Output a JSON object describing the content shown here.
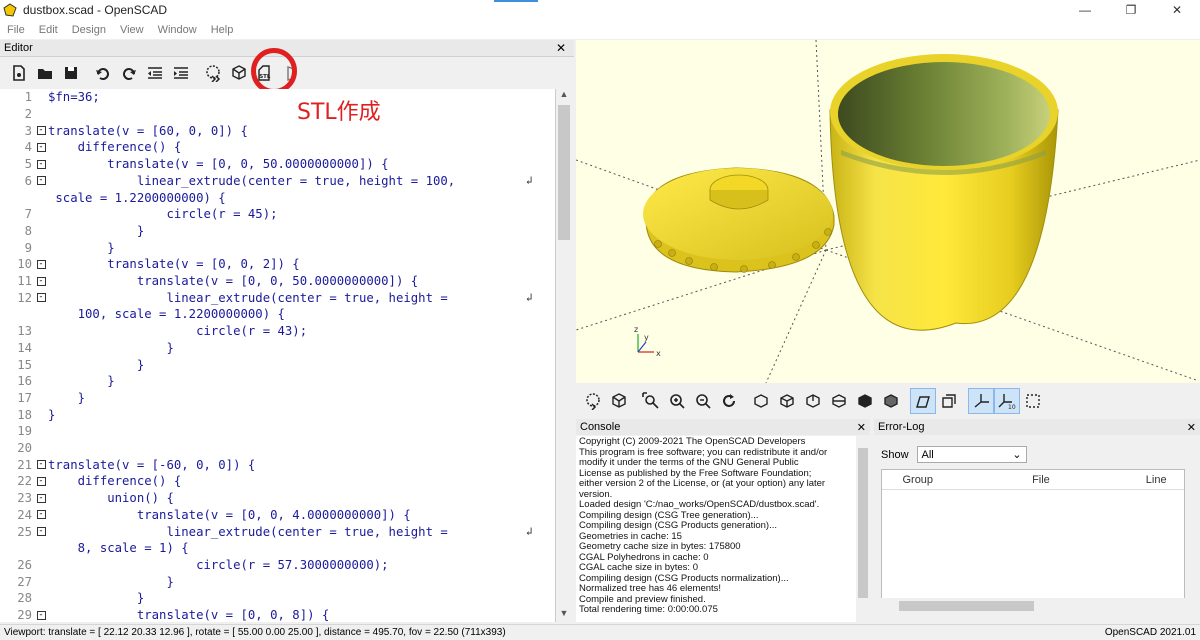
{
  "window": {
    "title": "dustbox.scad - OpenSCAD",
    "controls": [
      "—",
      "❐",
      "✕"
    ]
  },
  "menu": [
    "File",
    "Edit",
    "Design",
    "View",
    "Window",
    "Help"
  ],
  "editor": {
    "title": "Editor",
    "close": "✕",
    "annotation": "STL作成",
    "wrap_symbol": "↲",
    "lines": [
      {
        "n": "1",
        "fold": "",
        "text": "$fn=36;"
      },
      {
        "n": "2",
        "fold": "",
        "text": ""
      },
      {
        "n": "3",
        "fold": "-",
        "text": "translate(v = [60, 0, 0]) {"
      },
      {
        "n": "4",
        "fold": "-",
        "text": "    difference() {"
      },
      {
        "n": "5",
        "fold": "-",
        "text": "        translate(v = [0, 0, 50.0000000000]) {"
      },
      {
        "n": "6",
        "fold": "-",
        "text": "            linear_extrude(center = true, height = 100,",
        "wrap": true
      },
      {
        "n": "",
        "fold": "",
        "text": " scale = 1.2200000000) {"
      },
      {
        "n": "7",
        "fold": "",
        "text": "                circle(r = 45);"
      },
      {
        "n": "8",
        "fold": "",
        "text": "            }"
      },
      {
        "n": "9",
        "fold": "",
        "text": "        }"
      },
      {
        "n": "10",
        "fold": "-",
        "text": "        translate(v = [0, 0, 2]) {"
      },
      {
        "n": "11",
        "fold": "-",
        "text": "            translate(v = [0, 0, 50.0000000000]) {"
      },
      {
        "n": "12",
        "fold": "-",
        "text": "                linear_extrude(center = true, height =",
        "wrap": true
      },
      {
        "n": "",
        "fold": "",
        "text": "    100, scale = 1.2200000000) {"
      },
      {
        "n": "13",
        "fold": "",
        "text": "                    circle(r = 43);"
      },
      {
        "n": "14",
        "fold": "",
        "text": "                }"
      },
      {
        "n": "15",
        "fold": "",
        "text": "            }"
      },
      {
        "n": "16",
        "fold": "",
        "text": "        }"
      },
      {
        "n": "17",
        "fold": "",
        "text": "    }"
      },
      {
        "n": "18",
        "fold": "",
        "text": "}"
      },
      {
        "n": "19",
        "fold": "",
        "text": ""
      },
      {
        "n": "20",
        "fold": "",
        "text": ""
      },
      {
        "n": "21",
        "fold": "-",
        "text": "translate(v = [-60, 0, 0]) {"
      },
      {
        "n": "22",
        "fold": "-",
        "text": "    difference() {"
      },
      {
        "n": "23",
        "fold": "-",
        "text": "        union() {"
      },
      {
        "n": "24",
        "fold": "-",
        "text": "            translate(v = [0, 0, 4.0000000000]) {"
      },
      {
        "n": "25",
        "fold": "-",
        "text": "                linear_extrude(center = true, height =",
        "wrap": true
      },
      {
        "n": "",
        "fold": "",
        "text": "    8, scale = 1) {"
      },
      {
        "n": "26",
        "fold": "",
        "text": "                    circle(r = 57.3000000000);"
      },
      {
        "n": "27",
        "fold": "",
        "text": "                }"
      },
      {
        "n": "28",
        "fold": "",
        "text": "            }"
      },
      {
        "n": "29",
        "fold": "-",
        "text": "            translate(v = [0, 0, 8]) {"
      }
    ]
  },
  "console": {
    "title": "Console",
    "close": "✕",
    "lines": [
      "Copyright (C) 2009-2021 The OpenSCAD Developers",
      "This program is free software; you can redistribute it and/or",
      "modify it under the terms of the GNU General Public",
      "License as published by the Free Software Foundation;",
      "either version 2 of the License, or (at your option) any later",
      "version.",
      "",
      "Loaded design 'C:/nao_works/OpenSCAD/dustbox.scad'.",
      "Compiling design (CSG Tree generation)...",
      "Compiling design (CSG Products generation)...",
      "Geometries in cache: 15",
      "Geometry cache size in bytes: 175800",
      "CGAL Polyhedrons in cache: 0",
      "CGAL cache size in bytes: 0",
      "Compiling design (CSG Products normalization)...",
      "Normalized tree has 46 elements!",
      "Compile and preview finished.",
      "Total rendering time: 0:00:00.075"
    ]
  },
  "errorlog": {
    "title": "Error-Log",
    "close": "✕",
    "show_label": "Show",
    "show_value": "All",
    "columns": [
      "Group",
      "File",
      "Line"
    ]
  },
  "statusbar": {
    "viewport": "Viewport: translate = [ 22.12 20.33 12.96 ], rotate = [ 55.00 0.00 25.00 ], distance = 495.70, fov = 22.50 (711x393)",
    "version": "OpenSCAD 2021.01"
  },
  "colors": {
    "viewport_bg": "#ffffe5",
    "model": "#f5dc2c",
    "annotation": "#e02020",
    "code_text": "#1a1a9a"
  }
}
